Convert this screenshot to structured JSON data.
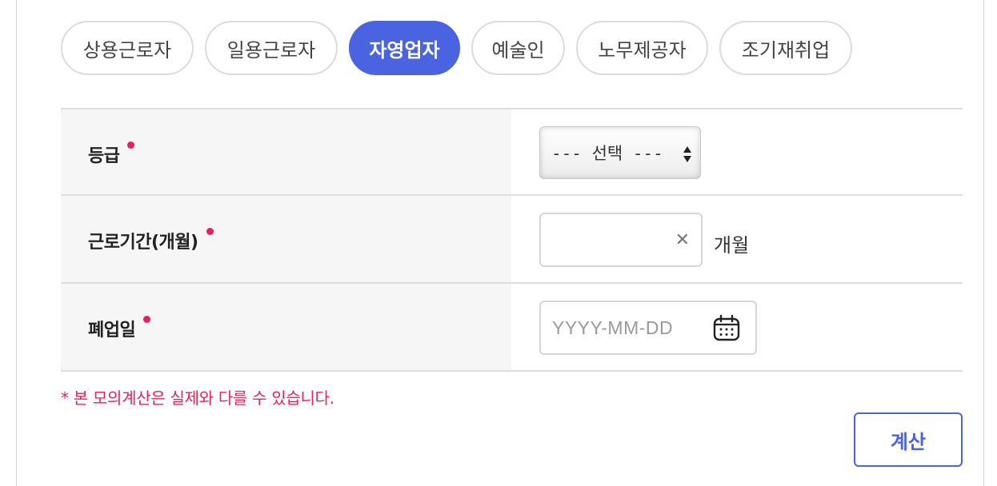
{
  "tabs": [
    {
      "label": "상용근로자",
      "active": false
    },
    {
      "label": "일용근로자",
      "active": false
    },
    {
      "label": "자영업자",
      "active": true
    },
    {
      "label": "예술인",
      "active": false
    },
    {
      "label": "노무제공자",
      "active": false
    },
    {
      "label": "조기재취업",
      "active": false
    }
  ],
  "form": {
    "grade": {
      "label": "등급",
      "select_value": "--- 선택 ---"
    },
    "work_period": {
      "label": "근로기간(개월)",
      "value": "",
      "unit": "개월"
    },
    "closure_date": {
      "label": "폐업일",
      "placeholder": "YYYY-MM-DD"
    }
  },
  "notice": "* 본 모의계산은 실제와 다를 수 있습니다.",
  "calc_button": "계산",
  "colors": {
    "accent": "#4a63e0",
    "required": "#e8215d",
    "label_bg": "#f6f6f6"
  },
  "icons": {
    "clear": "close-icon",
    "date": "calendar-icon",
    "select": "sort-arrows-icon"
  }
}
